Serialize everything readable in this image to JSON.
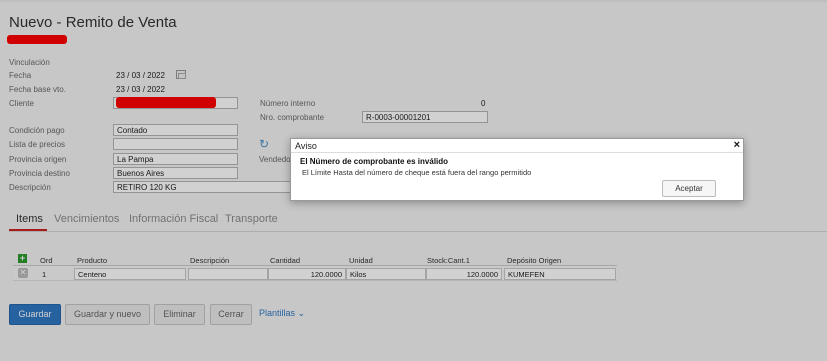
{
  "page": {
    "title": "Nuevo - Remito de Venta"
  },
  "form": {
    "vinculacion_label": "Vinculación",
    "fecha_label": "Fecha",
    "fecha_value": "23 / 03 / 2022",
    "fecha_vto_label": "Fecha base vto.",
    "fecha_vto_value": "23 / 03 / 2022",
    "cliente_label": "Cliente",
    "condicion_pago_label": "Condición pago",
    "condicion_pago_value": "Contado",
    "lista_precios_label": "Lista de precios",
    "lista_precios_value": "",
    "provincia_origen_label": "Provincia origen",
    "provincia_origen_value": "La Pampa",
    "provincia_destino_label": "Provincia destino",
    "provincia_destino_value": "Buenos Aires",
    "descripcion_label": "Descripción",
    "descripcion_value": "RETIRO 120 KG",
    "numero_interno_label": "Número interno",
    "numero_interno_value": "0",
    "nro_comprobante_label": "Nro. comprobante",
    "nro_comprobante_value": "R-0003-00001201",
    "vendedor_label": "Vendedo"
  },
  "tabs": [
    {
      "label": "Items",
      "active": true
    },
    {
      "label": "Vencimientos",
      "active": false
    },
    {
      "label": "Información Fiscal",
      "active": false
    },
    {
      "label": "Transporte",
      "active": false
    }
  ],
  "table": {
    "headers": {
      "ord": "Ord",
      "producto": "Producto",
      "descripcion": "Descripción",
      "cantidad": "Cantidad",
      "unidad": "Unidad",
      "stock": "Stock:Cant.1",
      "deposito": "Depósito Origen"
    },
    "rows": [
      {
        "ord": "1",
        "producto": "Centeno",
        "descripcion": "",
        "cantidad": "120.0000",
        "unidad": "Kilos",
        "stock": "120.0000",
        "deposito": "KUMEFEN"
      }
    ]
  },
  "actions": {
    "guardar": "Guardar",
    "guardar_nuevo": "Guardar y nuevo",
    "eliminar": "Eliminar",
    "cerrar": "Cerrar",
    "plantillas": "Plantillas"
  },
  "dialog": {
    "title": "Aviso",
    "close": "×",
    "heading": "El Número de comprobante es inválido",
    "message": "El Límite Hasta del número de cheque está fuera del rango permitido",
    "button": "Aceptar"
  },
  "colors": {
    "primary": "#2f78c4",
    "redaction": "#ff0000",
    "active_tab_underline": "#cc2222",
    "add_icon": "#2d9a2d"
  },
  "icons": {
    "calendar": "calendar-icon",
    "refresh": "refresh-icon",
    "add": "add-row-icon",
    "delete": "delete-row-icon",
    "chevron": "chevron-down-icon",
    "close": "close-icon"
  }
}
